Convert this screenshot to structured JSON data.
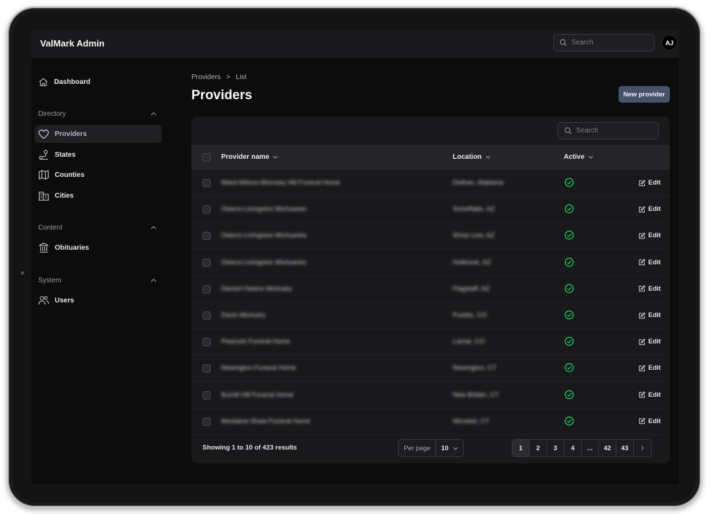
{
  "app": {
    "title": "ValMark Admin",
    "avatar_initials": "AJ"
  },
  "topbar": {
    "search_placeholder": "Search"
  },
  "sidebar": {
    "dashboard": "Dashboard",
    "groups": [
      {
        "label": "Directory",
        "items": [
          "Providers",
          "States",
          "Counties",
          "Cities"
        ]
      },
      {
        "label": "Content",
        "items": [
          "Obituaries"
        ]
      },
      {
        "label": "System",
        "items": [
          "Users"
        ]
      }
    ],
    "active_item": "Providers"
  },
  "breadcrumb": {
    "parent": "Providers",
    "separator": ">",
    "current": "List"
  },
  "page": {
    "title": "Providers",
    "new_button": "New provider"
  },
  "table": {
    "search_placeholder": "Search",
    "columns": {
      "name": "Provider name",
      "location": "Location",
      "active": "Active"
    },
    "edit_label": "Edit",
    "rows": [
      {
        "name": "Ward-Wilson-Mumsey Hill Funeral Home",
        "location": "Dothan, Alabama",
        "active": true
      },
      {
        "name": "Owens-Livingston Mortuaries",
        "location": "Snowflake, AZ",
        "active": true
      },
      {
        "name": "Owens-Livingston Mortuaries",
        "location": "Show Low, AZ",
        "active": true
      },
      {
        "name": "Owens-Livingston Mortuaries",
        "location": "Holbrook, AZ",
        "active": true
      },
      {
        "name": "Dansel-Owens Mortuary",
        "location": "Flagstaff, AZ",
        "active": true
      },
      {
        "name": "Davis Mortuary",
        "location": "Pueblo, CO",
        "active": true
      },
      {
        "name": "Peacock Funeral Home",
        "location": "Lamar, CO",
        "active": true
      },
      {
        "name": "Newington Funeral Home",
        "location": "Newington, CT",
        "active": true
      },
      {
        "name": "Bumill Hill Funeral Home",
        "location": "New Britain, CT",
        "active": true
      },
      {
        "name": "Montaine-Shaw Funeral Home",
        "location": "Winsted, CT",
        "active": true
      }
    ],
    "footer": {
      "showing": "Showing 1 to 10 of 423 results",
      "per_page_label": "Per page",
      "per_page_value": "10",
      "pages": [
        "1",
        "2",
        "3",
        "4",
        "...",
        "42",
        "43"
      ],
      "current_page": "1"
    }
  },
  "colors": {
    "background": "#0c0c0d",
    "panel": "#19191b",
    "accent_button": "#46526a",
    "active_nav_text": "#a9b8d4",
    "active_status": "#22c55e"
  },
  "icons": {
    "dashboard": "home-icon",
    "providers": "heart-icon",
    "states": "map-pin-route-icon",
    "counties": "map-icon",
    "cities": "buildings-icon",
    "obituaries": "building-columns-icon",
    "users": "users-icon",
    "search": "search-icon",
    "active": "check-circle-icon",
    "edit": "pencil-square-icon"
  }
}
